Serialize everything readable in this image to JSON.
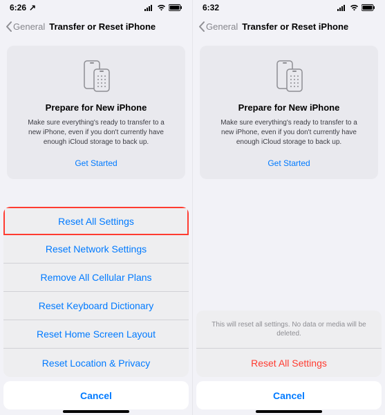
{
  "left": {
    "status": {
      "time": "6:26",
      "loc_icon": "↗"
    },
    "nav": {
      "back": "General",
      "title": "Transfer or Reset iPhone"
    },
    "card": {
      "title": "Prepare for New iPhone",
      "body": "Make sure everything's ready to transfer to a new iPhone, even if you don't currently have enough iCloud storage to back up.",
      "link": "Get Started"
    },
    "sheet": {
      "options": [
        "Reset All Settings",
        "Reset Network Settings",
        "Remove All Cellular Plans",
        "Reset Keyboard Dictionary",
        "Reset Home Screen Layout",
        "Reset Location & Privacy"
      ],
      "cancel": "Cancel"
    }
  },
  "right": {
    "status": {
      "time": "6:32"
    },
    "nav": {
      "back": "General",
      "title": "Transfer or Reset iPhone"
    },
    "card": {
      "title": "Prepare for New iPhone",
      "body": "Make sure everything's ready to transfer to a new iPhone, even if you don't currently have enough iCloud storage to back up.",
      "link": "Get Started"
    },
    "sheet": {
      "message": "This will reset all settings. No data or media will be deleted.",
      "confirm": "Reset All Settings",
      "cancel": "Cancel"
    }
  }
}
